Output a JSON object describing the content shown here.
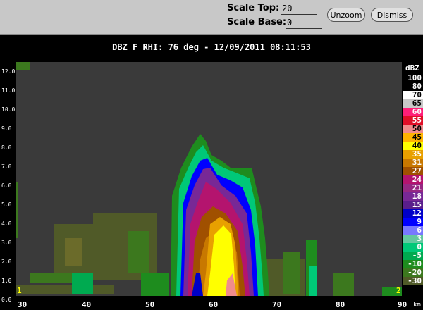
{
  "toolbar": {
    "scale_top_label": "Scale Top:",
    "scale_top_value": "20",
    "scale_base_label": "Scale Base:",
    "scale_base_value": "0",
    "unzoom_label": "Unzoom",
    "dismiss_label": "Dismiss"
  },
  "display": {
    "title": "DBZ F  RHI: 76 deg  -  12/09/2011 08:11:53",
    "y_ticks": [
      "12.0",
      "11.0",
      "10.0",
      "9.0",
      "8.0",
      "7.0",
      "6.0",
      "5.0",
      "4.0",
      "3.0",
      "2.0",
      "1.0",
      "0.0"
    ],
    "x_ticks": [
      "30",
      "40",
      "50",
      "60",
      "70",
      "80",
      "90"
    ],
    "x_unit": "km",
    "corner_left": "1",
    "corner_right": "2",
    "legend_unit": "dBZ",
    "legend": [
      {
        "label": "100",
        "color": "#000000"
      },
      {
        "label": "80",
        "color": "#000000"
      },
      {
        "label": "70",
        "color": "#ffffff"
      },
      {
        "label": "65",
        "color": "#c8c8c8"
      },
      {
        "label": "60",
        "color": "#ff1e78"
      },
      {
        "label": "55",
        "color": "#e00f28"
      },
      {
        "label": "50",
        "color": "#f08c8c"
      },
      {
        "label": "45",
        "color": "#ffb400"
      },
      {
        "label": "40",
        "color": "#ffff00"
      },
      {
        "label": "35",
        "color": "#e8a000"
      },
      {
        "label": "31",
        "color": "#c87800"
      },
      {
        "label": "27",
        "color": "#a05000"
      },
      {
        "label": "24",
        "color": "#b4146e"
      },
      {
        "label": "21",
        "color": "#962882"
      },
      {
        "label": "18",
        "color": "#782896"
      },
      {
        "label": "15",
        "color": "#5a1e8c"
      },
      {
        "label": "12",
        "color": "#0000c8"
      },
      {
        "label": "9",
        "color": "#0000ff"
      },
      {
        "label": "6",
        "color": "#7878ff"
      },
      {
        "label": "3",
        "color": "#64c8a0"
      },
      {
        "label": "0",
        "color": "#00c878"
      },
      {
        "label": "-5",
        "color": "#00aa50"
      },
      {
        "label": "-10",
        "color": "#1e8c1e"
      },
      {
        "label": "-20",
        "color": "#3c781e"
      },
      {
        "label": "-30",
        "color": "#505a28"
      }
    ]
  }
}
